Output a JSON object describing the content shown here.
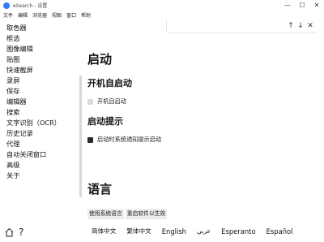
{
  "window": {
    "title": "eSearch - 设置",
    "minimize_glyph": "—",
    "maximize_glyph": "☐",
    "close_glyph": "✕"
  },
  "menu": [
    "文件",
    "编辑",
    "浏览器",
    "视图",
    "窗口",
    "帮助"
  ],
  "findbar": {
    "up_glyph": "↑",
    "down_glyph": "↓",
    "close_glyph": "✕"
  },
  "sidebar": {
    "items": [
      "取色器",
      "框选",
      "图像编辑",
      "贴图",
      "快速截屏",
      "录屏",
      "保存",
      "编辑器",
      "搜索",
      "文字识别（OCR）",
      "历史记录",
      "代理",
      "自动关闭窗口",
      "高级",
      "关于"
    ],
    "help_glyph": "?"
  },
  "main": {
    "section_startup": "启动",
    "autostart_heading": "开机自启动",
    "autostart_label": "开机自启动",
    "autostart_checked": false,
    "startup_tip_heading": "启动提示",
    "startup_tip_label": "启动时系统通知提示启动",
    "startup_tip_checked": true,
    "section_language": "语言",
    "btn_use_system_lang": "使用系统语言",
    "btn_restart": "重启软件以生效",
    "languages": [
      "简体中文",
      "繁体中文",
      "English",
      "عربي",
      "Esperanto",
      "Español"
    ]
  },
  "colors": {
    "app_icon": "#2f7cf6",
    "checkbox_off": "#dcdcdc",
    "checkbox_on": "#2a2a2a",
    "button_bg": "#ececec"
  }
}
